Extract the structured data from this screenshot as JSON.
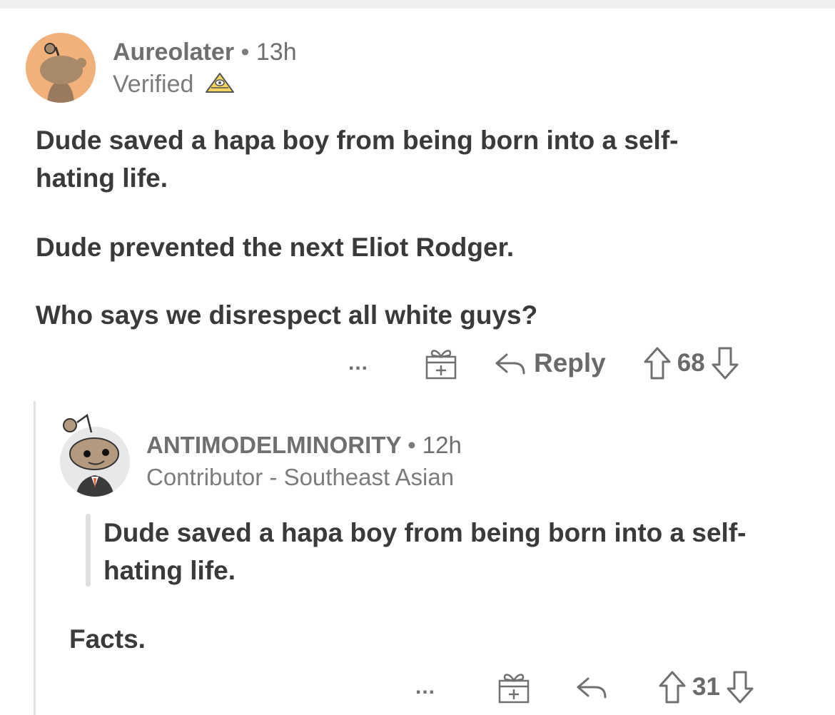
{
  "colors": {
    "avatar1_bg": "#f2b17a",
    "avatar2_bg": "#e7e8ea",
    "text": "#3a3a3a",
    "meta": "#7c7c7c"
  },
  "comment1": {
    "username": "Aureolater",
    "separator": "•",
    "time": "13h",
    "flair": "Verified",
    "flair_icon": "pyramid-eye-icon",
    "paragraphs": [
      "Dude saved a hapa boy from being born into a self-hating life.",
      "Dude prevented the next Eliot Rodger.",
      "Who says we disrespect all white guys?"
    ],
    "actions": {
      "more": "...",
      "award_icon": "gift-icon",
      "reply_label": "Reply",
      "score": "68"
    }
  },
  "comment2": {
    "username": "ANTIMODELMINORITY",
    "separator": "•",
    "time": "12h",
    "flair": "Contributor - Southeast Asian",
    "quote": "Dude saved a hapa boy from being born into a self-hating life.",
    "body": "Facts.",
    "actions": {
      "more": "...",
      "award_icon": "gift-icon",
      "score": "31"
    }
  }
}
